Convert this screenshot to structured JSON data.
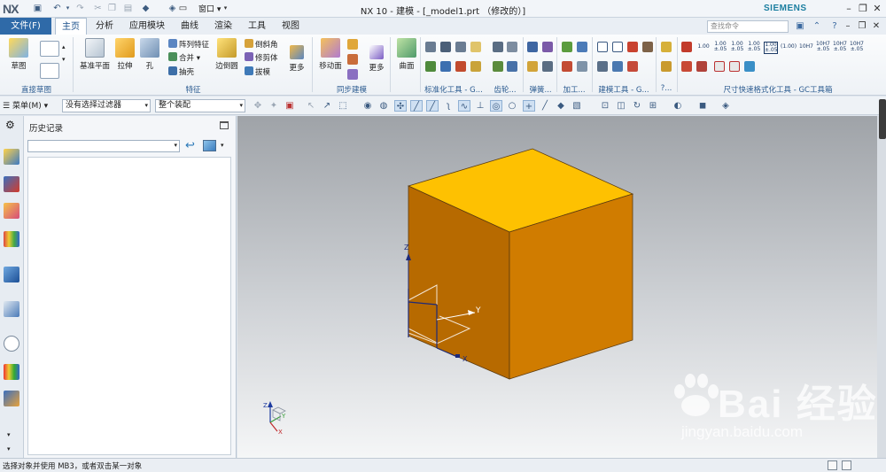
{
  "titlebar": {
    "logo": "NX",
    "window_menu": "窗口",
    "title": "NX 10 - 建模 - [_model1.prt （修改的）]",
    "brand": "SIEMENS"
  },
  "tabs": {
    "file": "文件(F)",
    "items": [
      "主页",
      "分析",
      "应用模块",
      "曲线",
      "渲染",
      "工具",
      "视图"
    ],
    "active_index": 0,
    "search_placeholder": "查找命令"
  },
  "ribbon": {
    "sketch": "草图",
    "datum_plane": "基准平面",
    "extrude": "拉伸",
    "hole": "孔",
    "pattern_feature": "阵列特征",
    "unite": "合并",
    "shell": "抽壳",
    "edge_blend": "边倒圆",
    "chamfer": "倒斜角",
    "trim_body": "修剪体",
    "draft": "拔模",
    "more": "更多",
    "move_face": "移动面",
    "more2": "更多",
    "surface": "曲面",
    "groups": {
      "direct_sketch": "直接草图",
      "feature": "特征",
      "sync_modeling": "同步建模",
      "standard_tools": "标准化工具 - G...",
      "gear": "齿轮...",
      "spring": "弹簧...",
      "machining": "加工...",
      "modeling_tools": "建模工具 - G...",
      "more_q": "?...",
      "dim_tools": "尺寸快速格式化工具 - GC工具箱"
    },
    "dim_labels": [
      "1.00",
      "1.00\n±.05",
      "1.00\n±.05",
      "1.00\n±.05",
      "1.00\n±.05",
      "(1.00)",
      "10H7",
      "10H7\n±.05",
      "10H7\n±.05",
      "10H7\n±.05"
    ]
  },
  "selbar": {
    "menu": "菜单(M)",
    "filter": "没有选择过滤器",
    "scope": "整个装配"
  },
  "panel": {
    "title": "历史记录"
  },
  "viewport": {
    "axes": {
      "x": "X",
      "y": "Y",
      "z": "Z"
    },
    "mini_axes": {
      "x": "X",
      "y": "Y",
      "z": "Z"
    },
    "colors": {
      "top": "#fec101",
      "front": "#b76a00",
      "right": "#d07c00",
      "edge": "#5b3b10"
    }
  },
  "status": {
    "text": "选择对象并使用 MB3，或者双击某一对象"
  },
  "watermark": {
    "main": "Bai 经验",
    "sub": "jingyan.baidu.com"
  }
}
